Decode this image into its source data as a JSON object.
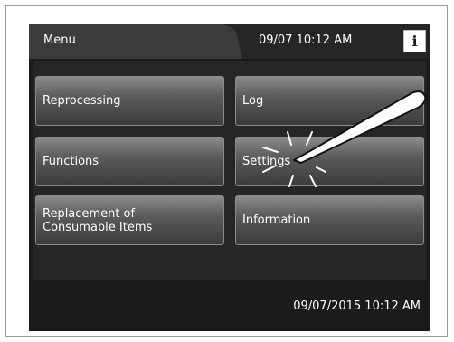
{
  "header": {
    "title": "Menu",
    "datetime": "09/07 10:12 AM",
    "info_icon": "info-icon"
  },
  "menu": {
    "buttons": [
      {
        "label": "Reprocessing"
      },
      {
        "label": "Log"
      },
      {
        "label": "Functions"
      },
      {
        "label": "Settings"
      },
      {
        "label": "Replacement of\nConsumable Items"
      },
      {
        "label": "Information"
      }
    ]
  },
  "footer": {
    "datetime": "09/07/2015 10:12 AM"
  },
  "annotation": {
    "stylus_icon": "stylus-icon",
    "tap_icon": "tap-indicator-icon"
  },
  "colors": {
    "screen_background": "#1b1b1b",
    "button_top": "#8b8b8b",
    "button_bottom": "#3b3b3b",
    "text": "#ffffff"
  }
}
